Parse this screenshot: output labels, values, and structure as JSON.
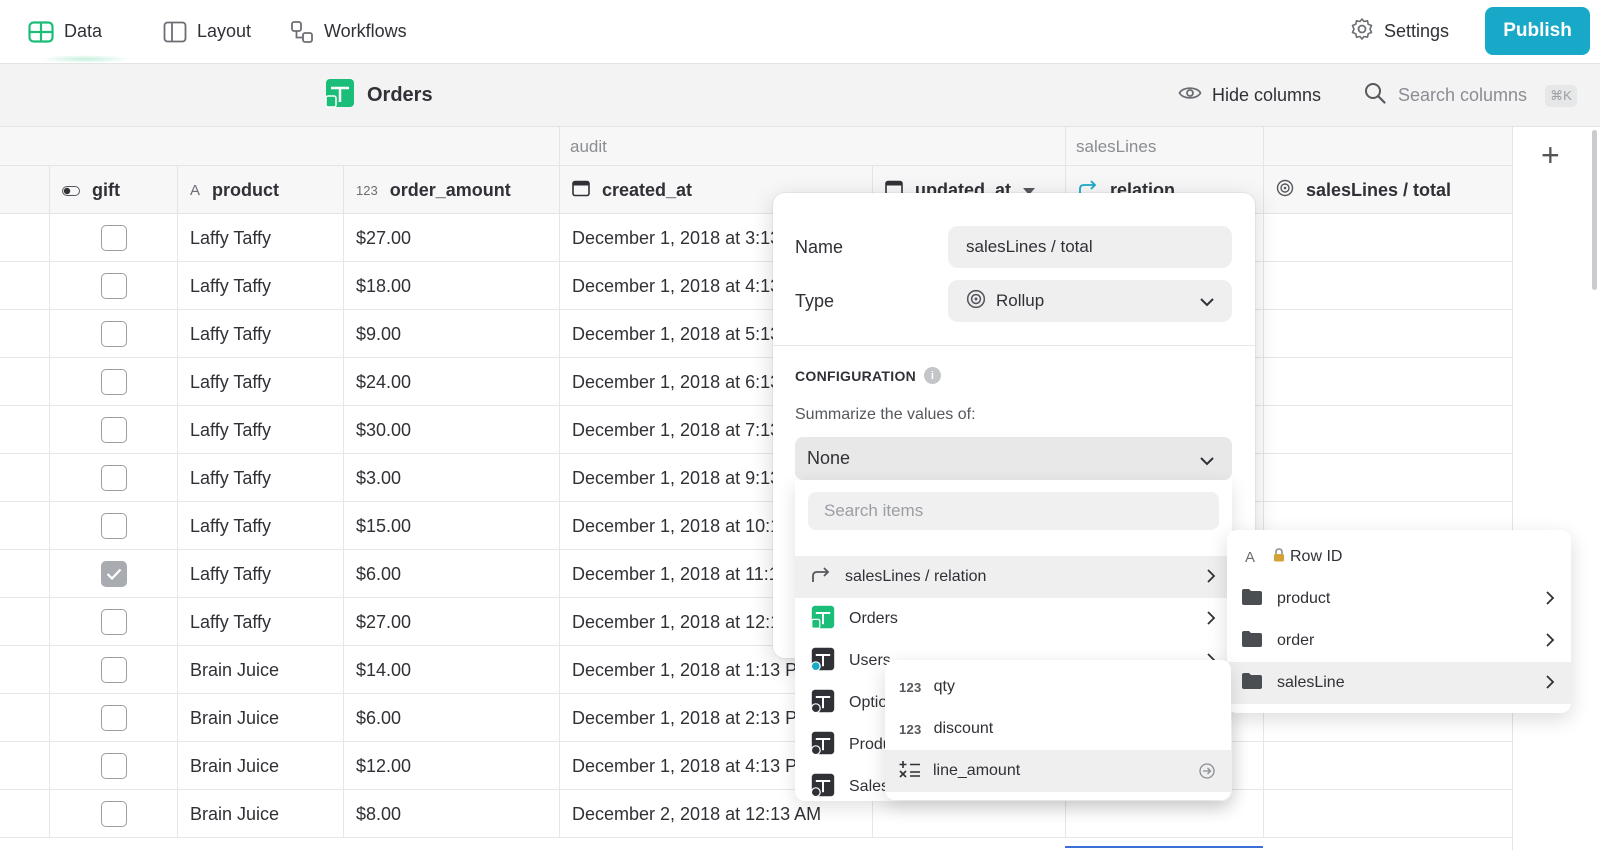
{
  "nav": {
    "tabs": [
      {
        "label": "Data",
        "icon": "table-icon",
        "active": true
      },
      {
        "label": "Layout",
        "icon": "layout-icon"
      },
      {
        "label": "Workflows",
        "icon": "workflows-icon"
      }
    ],
    "settings_label": "Settings",
    "publish_label": "Publish"
  },
  "toolbar": {
    "table_name": "Orders",
    "hide_columns_label": "Hide columns",
    "search_placeholder": "Search columns",
    "search_shortcut": "⌘K"
  },
  "grid": {
    "groups": [
      {
        "label": "audit"
      },
      {
        "label": "salesLines"
      }
    ],
    "columns": [
      {
        "label": "gift",
        "type_icon": "toggle-icon"
      },
      {
        "label": "product",
        "type_icon": "A"
      },
      {
        "label": "order_amount",
        "type_icon": "123"
      },
      {
        "label": "created_at",
        "type_icon": "calendar-icon"
      },
      {
        "label": "updated_at",
        "type_icon": "calendar-icon"
      },
      {
        "label": "relation",
        "type_icon": "relation-icon"
      },
      {
        "label": "salesLines / total",
        "type_icon": "rollup-icon"
      }
    ],
    "rows": [
      {
        "gift": false,
        "product": "Laffy Taffy",
        "order_amount": "$27.00",
        "created_at": "December 1, 2018 at 3:13"
      },
      {
        "gift": false,
        "product": "Laffy Taffy",
        "order_amount": "$18.00",
        "created_at": "December 1, 2018 at 4:13"
      },
      {
        "gift": false,
        "product": "Laffy Taffy",
        "order_amount": "$9.00",
        "created_at": "December 1, 2018 at 5:13"
      },
      {
        "gift": false,
        "product": "Laffy Taffy",
        "order_amount": "$24.00",
        "created_at": "December 1, 2018 at 6:13"
      },
      {
        "gift": false,
        "product": "Laffy Taffy",
        "order_amount": "$30.00",
        "created_at": "December 1, 2018 at 7:13"
      },
      {
        "gift": false,
        "product": "Laffy Taffy",
        "order_amount": "$3.00",
        "created_at": "December 1, 2018 at 9:13"
      },
      {
        "gift": false,
        "product": "Laffy Taffy",
        "order_amount": "$15.00",
        "created_at": "December 1, 2018 at 10:1"
      },
      {
        "gift": true,
        "product": "Laffy Taffy",
        "order_amount": "$6.00",
        "created_at": "December 1, 2018 at 11:13"
      },
      {
        "gift": false,
        "product": "Laffy Taffy",
        "order_amount": "$27.00",
        "created_at": "December 1, 2018 at 12:1"
      },
      {
        "gift": false,
        "product": "Brain Juice",
        "order_amount": "$14.00",
        "created_at": "December 1, 2018 at 1:13 PM"
      },
      {
        "gift": false,
        "product": "Brain Juice",
        "order_amount": "$6.00",
        "created_at": "December 1, 2018 at 2:13 PM"
      },
      {
        "gift": false,
        "product": "Brain Juice",
        "order_amount": "$12.00",
        "created_at": "December 1, 2018 at 4:13 PM"
      },
      {
        "gift": false,
        "product": "Brain Juice",
        "order_amount": "$8.00",
        "created_at": "December 2, 2018 at 12:13 AM"
      }
    ]
  },
  "popover": {
    "name_label": "Name",
    "name_value": "salesLines / total",
    "type_label": "Type",
    "type_value": "Rollup",
    "configuration_label": "CONFIGURATION",
    "summarize_label": "Summarize the values of:",
    "summarize_value": "None"
  },
  "dropdown": {
    "search_placeholder": "Search items",
    "items": [
      {
        "label": "salesLines / relation",
        "icon": "relation-icon",
        "highlighted": true
      },
      {
        "label": "Orders",
        "icon": "table-green-icon"
      },
      {
        "label": "Users",
        "icon": "table-user-icon"
      },
      {
        "label": "Optio",
        "icon": "table-dark-icon"
      },
      {
        "label": "Produ",
        "icon": "table-dark-icon"
      },
      {
        "label": "Sales",
        "icon": "table-dark-icon"
      }
    ]
  },
  "submenu_relation": {
    "items": [
      {
        "label": "Row ID",
        "icon": "lock-icon",
        "type": "A"
      },
      {
        "label": "product",
        "icon": "folder-icon"
      },
      {
        "label": "order",
        "icon": "folder-icon"
      },
      {
        "label": "salesLine",
        "icon": "folder-icon",
        "highlighted": true
      }
    ]
  },
  "submenu_salesline": {
    "items": [
      {
        "label": "qty",
        "type": "123"
      },
      {
        "label": "discount",
        "type": "123"
      },
      {
        "label": "line_amount",
        "icon": "formula-icon",
        "highlighted": true
      }
    ]
  },
  "colors": {
    "publish": "#17a9c7",
    "brand_green": "#1bbe78",
    "highlight": "#efeff0"
  }
}
